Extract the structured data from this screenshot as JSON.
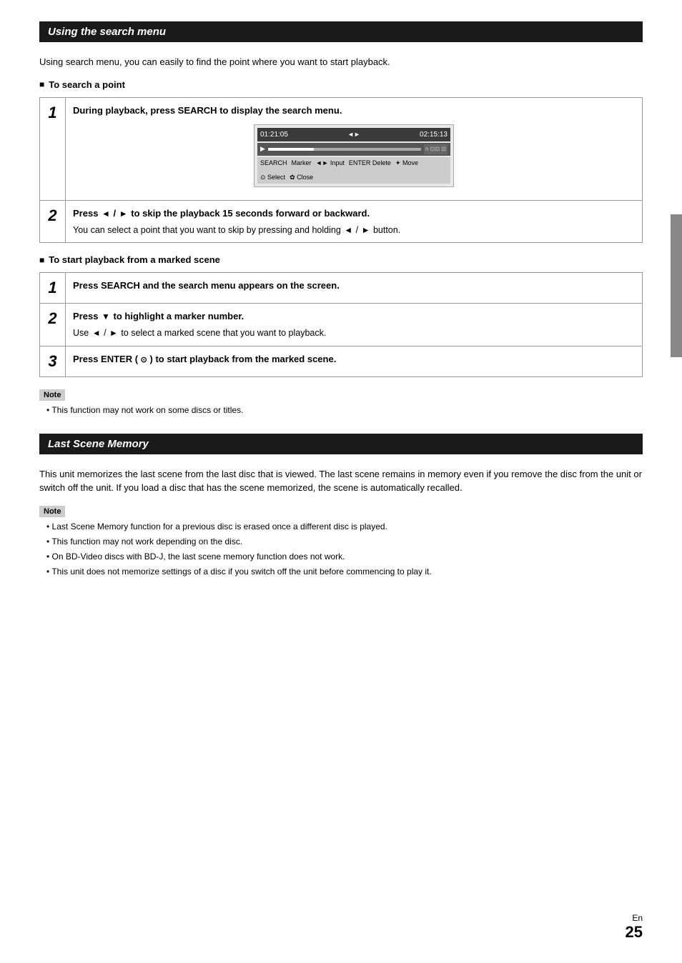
{
  "page": {
    "number": "25",
    "lang": "En"
  },
  "section1": {
    "title": "Using the search menu",
    "intro": "Using search menu, you can easily to find the point where you want to start playback.",
    "subsection1": {
      "heading": "To search a point",
      "steps": [
        {
          "num": "1",
          "main": "During playback, press SEARCH to display the search menu."
        },
        {
          "num": "2",
          "main": "Press  /  to skip the playback 15 seconds forward or backward.",
          "sub": "You can select a point that you want to skip by pressing and holding  /  button."
        }
      ]
    },
    "subsection2": {
      "heading": "To start playback from a marked scene",
      "steps": [
        {
          "num": "1",
          "main": "Press SEARCH and the search menu appears on the screen."
        },
        {
          "num": "2",
          "main": "Press  to highlight a marker number.",
          "sub": "Use  /  to select a marked scene that you want to playback."
        },
        {
          "num": "3",
          "main": "Press ENTER (  ) to start playback from the marked scene."
        }
      ]
    },
    "note": {
      "label": "Note",
      "items": [
        "This function may not work on some discs or titles."
      ]
    },
    "screen": {
      "time_left": "01:21:05",
      "time_right": "02:15:13",
      "controls": "SEARCH  Marker  ◄ ► Input  ENTER Delete  ✦ Move  ⊙ Select  ✿ Close"
    }
  },
  "section2": {
    "title": "Last Scene Memory",
    "intro": "This unit memorizes the last scene from the last disc that is viewed. The last scene remains in memory even if you remove the disc from the unit or switch off the unit. If you load a disc that has the scene memorized, the scene is automatically recalled.",
    "note": {
      "label": "Note",
      "items": [
        "Last Scene Memory function for a previous disc is erased once a different disc is played.",
        "This function may not work depending on the disc.",
        "On BD-Video discs with BD-J, the last scene memory function does not work.",
        "This unit does not memorize settings of a disc if you switch off the unit before commencing to play it."
      ]
    }
  }
}
